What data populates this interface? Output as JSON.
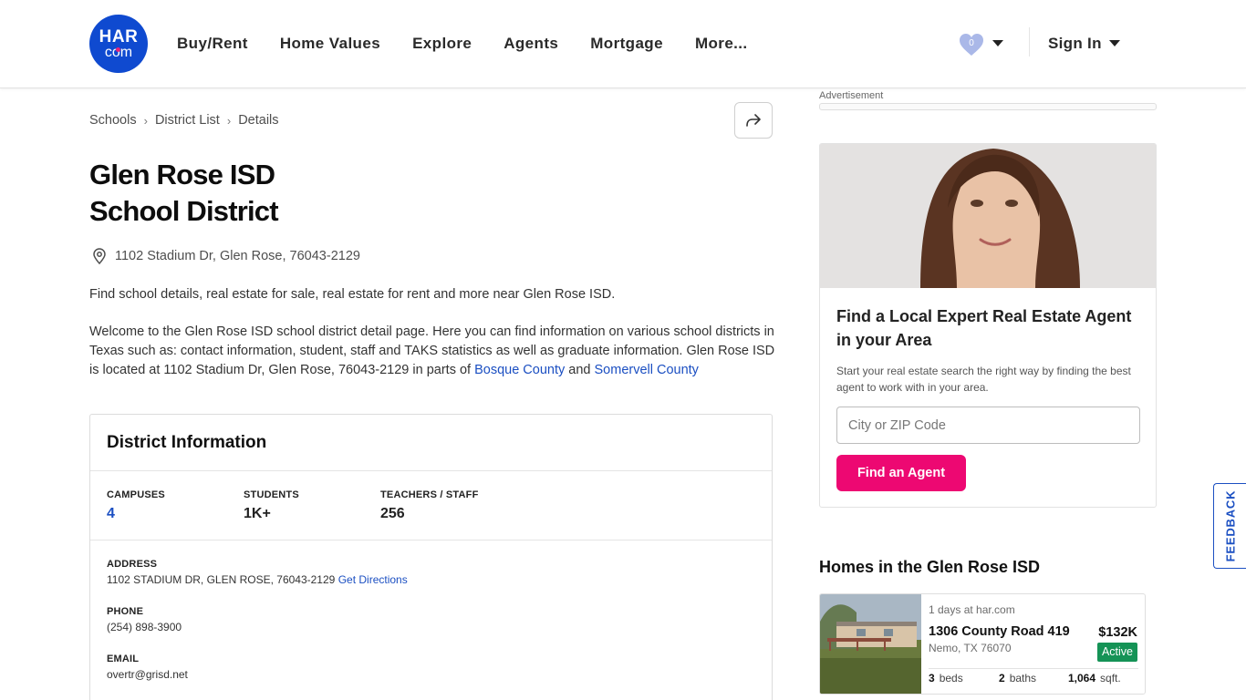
{
  "header": {
    "logo_top": "HAR",
    "logo_bottom": "com",
    "nav": [
      "Buy/Rent",
      "Home Values",
      "Explore",
      "Agents",
      "Mortgage",
      "More..."
    ],
    "favorites_count": "0",
    "sign_in": "Sign In"
  },
  "breadcrumb": [
    "Schools",
    "District List",
    "Details"
  ],
  "page": {
    "title_line1": "Glen Rose ISD",
    "title_line2": "School District",
    "address": "1102 Stadium Dr, Glen Rose, 76043-2129",
    "intro": "Find school details, real estate for sale, real estate for rent and more near Glen Rose ISD.",
    "welcome": "Welcome to the Glen Rose ISD school district detail page. Here you can find information on various school districts in Texas such as: contact information, student, staff and TAKS statistics as well as graduate information. Glen Rose ISD is located at 1102 Stadium Dr, Glen Rose, 76043-2129 in parts of ",
    "county1": "Bosque County",
    "and": " and ",
    "county2": "Somervell County"
  },
  "district_info": {
    "title": "District Information",
    "stats": [
      {
        "label": "CAMPUSES",
        "value": "4"
      },
      {
        "label": "STUDENTS",
        "value": "1K+"
      },
      {
        "label": "TEACHERS / STAFF",
        "value": "256"
      }
    ],
    "address_label": "ADDRESS",
    "address_value": "1102 STADIUM DR, GLEN ROSE, 76043-2129",
    "directions": "Get Directions",
    "phone_label": "PHONE",
    "phone_value": "(254) 898-3900",
    "email_label": "EMAIL",
    "email_value": "overtr@grisd.net"
  },
  "ad": {
    "label": "Advertisement"
  },
  "agent_card": {
    "heading": "Find a Local Expert Real Estate Agent in your Area",
    "text": "Start your real estate search the right way by finding the best agent to work with in your area.",
    "input_placeholder": "City or ZIP Code",
    "button": "Find an Agent"
  },
  "homes": {
    "title": "Homes in the Glen Rose ISD",
    "items": [
      {
        "ago": "1 days at har.com",
        "street": "1306 County Road 419",
        "city": "Nemo, TX 76070",
        "price": "$132K",
        "status": "Active",
        "beds": "3",
        "beds_label": "beds",
        "baths": "2",
        "baths_label": "baths",
        "sqft": "1,064",
        "sqft_label": "sqft."
      }
    ]
  },
  "feedback": "FEEDBACK",
  "colors": {
    "brand_blue": "#0f4ad0",
    "link": "#1b4fc2",
    "pink": "#ed0872",
    "active_green": "#159356"
  }
}
